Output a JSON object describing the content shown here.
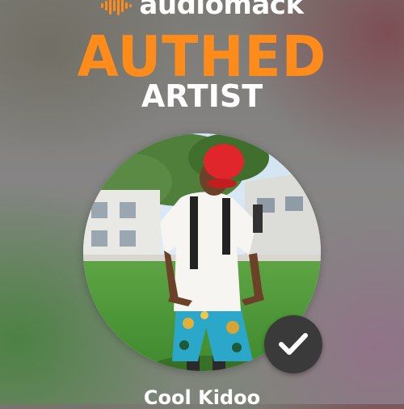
{
  "brand": {
    "name": "audiomack",
    "icon": "waveform-logo-icon",
    "color": "#ff8c1a"
  },
  "headline": "AUTHED",
  "subheadline": "ARTIST",
  "profile": {
    "name": "Cool Kidoo",
    "photo_alt": "artist-photo",
    "verified_icon": "check-icon"
  },
  "colors": {
    "accent": "#ff8c1a",
    "text": "#ffffff",
    "badge": "#3a3a3a"
  }
}
